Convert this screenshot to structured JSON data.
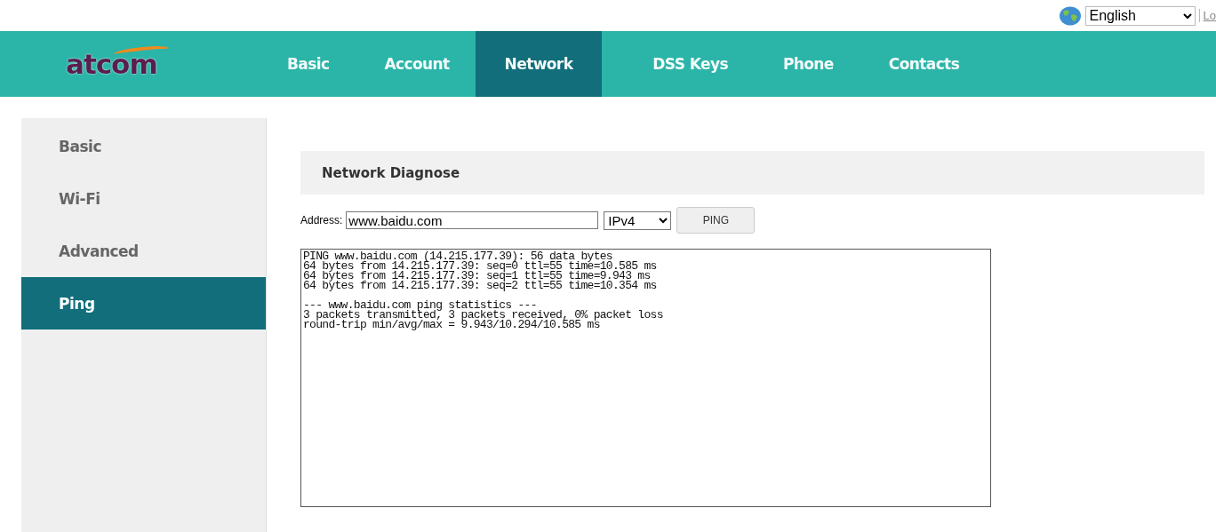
{
  "top_bar": {
    "language": "English",
    "link": "Lo"
  },
  "logo": "atcom",
  "nav_tabs": [
    {
      "label": "Basic",
      "selected": false
    },
    {
      "label": "Account",
      "selected": false
    },
    {
      "label": "Network",
      "selected": true
    },
    {
      "label": "DSS Keys",
      "selected": false
    },
    {
      "label": "Phone",
      "selected": false
    },
    {
      "label": "Contacts",
      "selected": false
    }
  ],
  "sidebar": {
    "items": [
      {
        "label": "Basic",
        "selected": false
      },
      {
        "label": "Wi-Fi",
        "selected": false
      },
      {
        "label": "Advanced",
        "selected": false
      },
      {
        "label": "Ping",
        "selected": true
      }
    ]
  },
  "section": {
    "title": "Network Diagnose",
    "address_label": "Address:",
    "address_value": "www.baidu.com",
    "protocol": "IPv4",
    "button": "PING",
    "output": "PING www.baidu.com (14.215.177.39): 56 data bytes\n64 bytes from 14.215.177.39: seq=0 ttl=55 time=10.585 ms\n64 bytes from 14.215.177.39: seq=1 ttl=55 time=9.943 ms\n64 bytes from 14.215.177.39: seq=2 ttl=55 time=10.354 ms\n\n--- www.baidu.com ping statistics ---\n3 packets transmitted, 3 packets received, 0% packet loss\nround-trip min/avg/max = 9.943/10.294/10.585 ms"
  }
}
